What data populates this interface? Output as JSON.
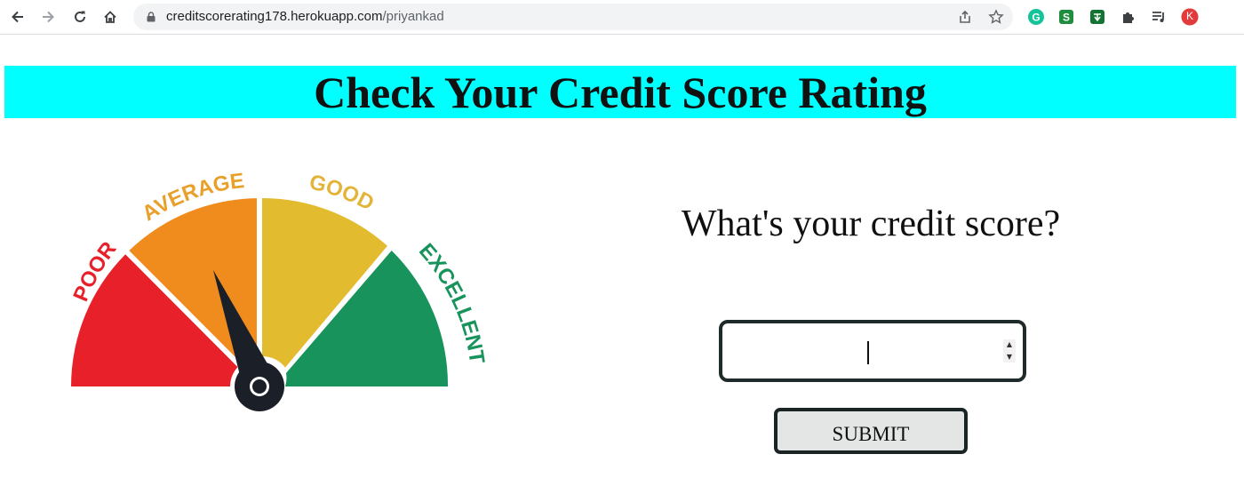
{
  "browser": {
    "url_host": "creditscorerating178.herokuapp.com",
    "url_path": "/priyankad",
    "profile_initial": "K"
  },
  "page": {
    "title": "Check Your Credit Score Rating",
    "question": "What's your credit score?",
    "score_input": {
      "value": "",
      "placeholder": ""
    },
    "submit_label": "SUBMIT"
  },
  "gauge": {
    "segments": [
      {
        "label": "POOR",
        "color": "#e8202a"
      },
      {
        "label": "AVERAGE",
        "color": "#f08b1e"
      },
      {
        "label": "GOOD",
        "color": "#e3bb2f"
      },
      {
        "label": "EXCELLENT",
        "color": "#17935b"
      }
    ],
    "needle_segment": "AVERAGE"
  },
  "colors": {
    "header_bg": "#00ffff",
    "poor": "#e8202a",
    "average": "#f08b1e",
    "good": "#e3bb2f",
    "excellent": "#17935b",
    "needle": "#1b1f28"
  }
}
